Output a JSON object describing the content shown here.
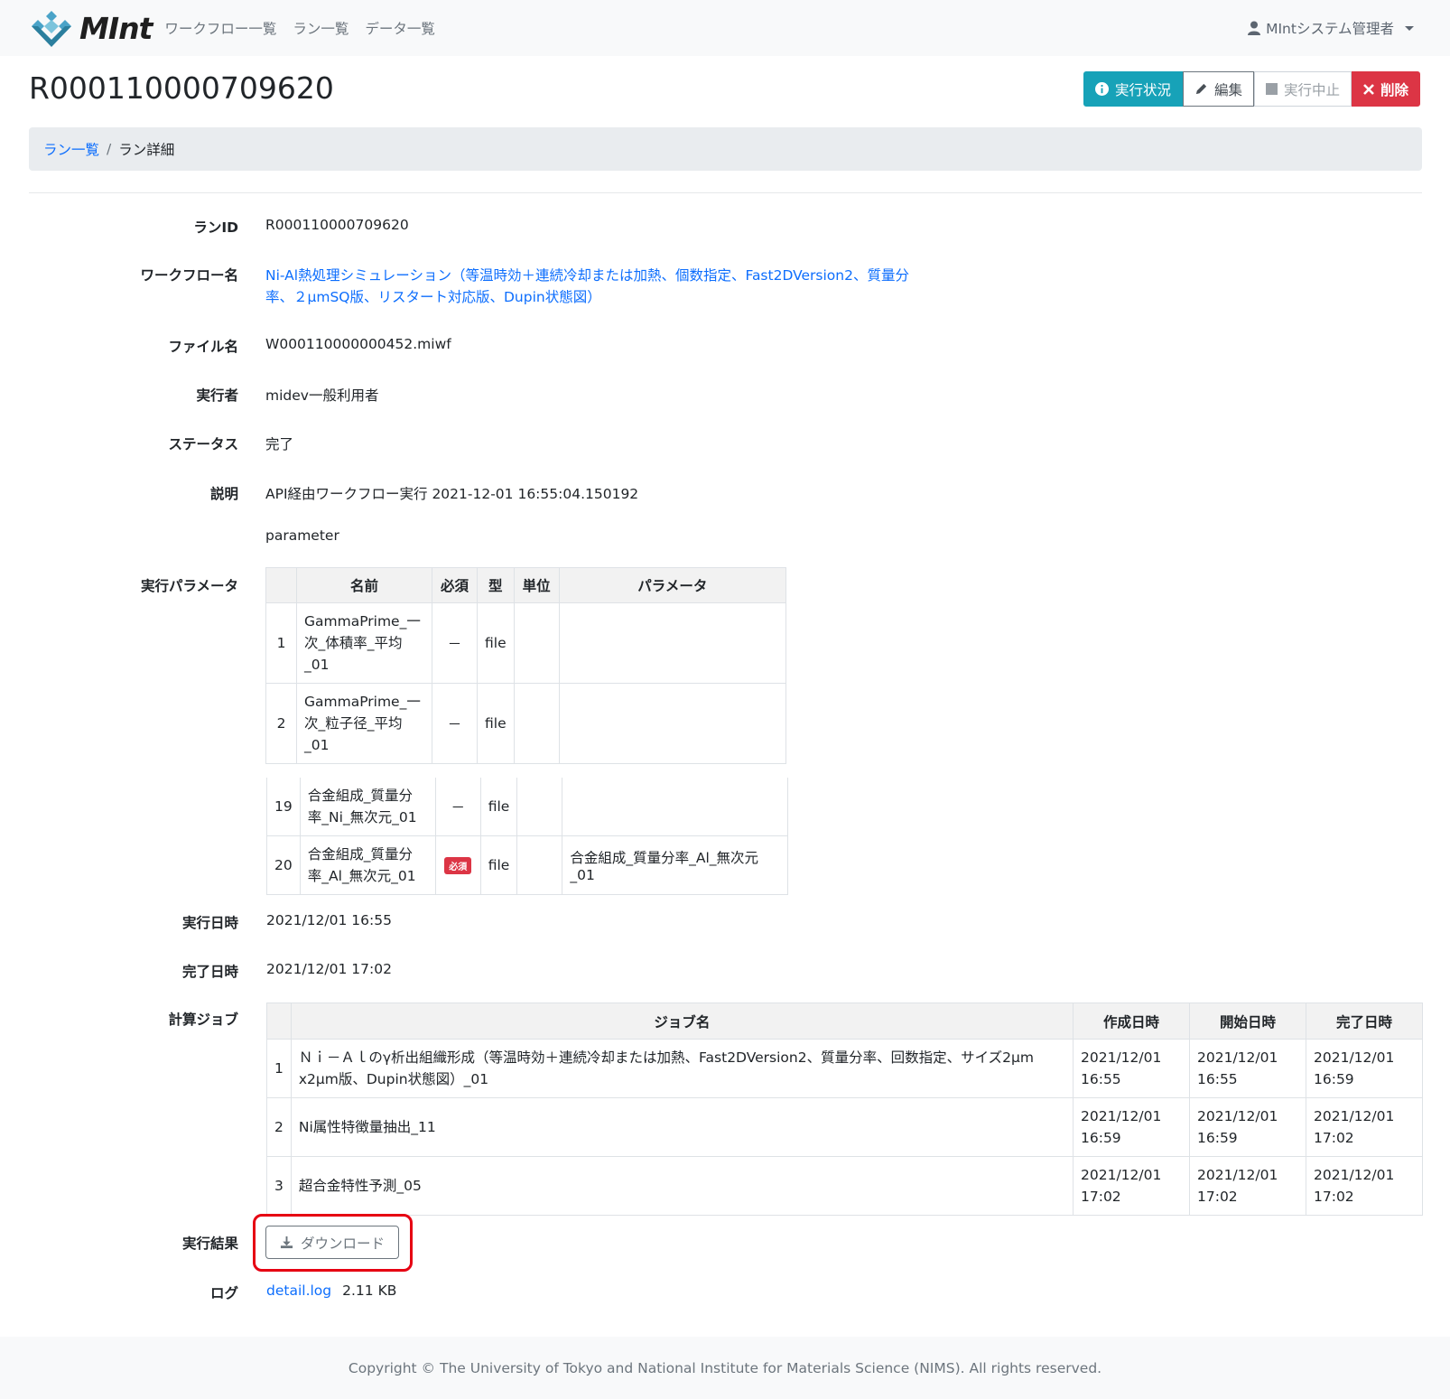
{
  "nav": {
    "brand": "MInt",
    "links": [
      "ワークフロー一覧",
      "ラン一覧",
      "データ一覧"
    ],
    "user": "MIntシステム管理者"
  },
  "header": {
    "title": "R000110000709620",
    "buttons": {
      "status": "実行状況",
      "edit": "編集",
      "stop": "実行中止",
      "delete": "削除"
    }
  },
  "breadcrumb": {
    "parent": "ラン一覧",
    "separator": "/",
    "current": "ラン詳細"
  },
  "details": {
    "run_id_label": "ランID",
    "run_id": "R000110000709620",
    "workflow_label": "ワークフロー名",
    "workflow_line1": "Ni-Al熱処理シミュレーション（等温時効＋連続冷却または加熱、個数指定、Fast2DVersion2、質量分",
    "workflow_line2": "率、２μmSQ版、リスタート対応版、Dupin状態図）",
    "file_label": "ファイル名",
    "file": "W000110000000452.miwf",
    "executor_label": "実行者",
    "executor": "midev一般利用者",
    "status_label": "ステータス",
    "status": "完了",
    "desc_label": "説明",
    "desc": "API経由ワークフロー実行 2021-12-01 16:55:04.150192",
    "desc_sub": "parameter",
    "params_label": "実行パラメータ",
    "start_label": "実行日時",
    "start": "2021/12/01 16:55",
    "end_label": "完了日時",
    "end": "2021/12/01 17:02",
    "jobs_label": "計算ジョブ",
    "result_label": "実行結果",
    "download": "ダウンロード",
    "log_label": "ログ",
    "log_file": "detail.log",
    "log_size": "2.11 KB"
  },
  "params_table": {
    "headers": [
      "",
      "名前",
      "必須",
      "型",
      "単位",
      "パラメータ"
    ],
    "rows": [
      {
        "no": "1",
        "name": [
          "GammaPrime_一",
          "次_体積率_平均",
          "_01"
        ],
        "req": "－",
        "type": "file",
        "unit": "",
        "param": ""
      },
      {
        "no": "2",
        "name": [
          "GammaPrime_一",
          "次_粒子径_平均",
          "_01"
        ],
        "req": "－",
        "type": "file",
        "unit": "",
        "param": ""
      },
      {
        "no": "19",
        "name": [
          "合金組成_質量分",
          "率_Ni_無次元_01"
        ],
        "req": "－",
        "type": "file",
        "unit": "",
        "param": ""
      },
      {
        "no": "20",
        "name": [
          "合金組成_質量分",
          "率_Al_無次元_01"
        ],
        "req": "必須",
        "type": "file",
        "unit": "",
        "param": "合金組成_質量分率_Al_無次元_01"
      }
    ]
  },
  "jobs_table": {
    "headers": [
      "",
      "ジョブ名",
      "作成日時",
      "開始日時",
      "完了日時"
    ],
    "rows": [
      {
        "no": "1",
        "name": [
          "Ｎｉ－Ａｌのγ析出組織形成（等温時効＋連続冷却または加熱、Fast2DVersion2、質量分率、回数指定、サイズ2μm",
          "x2μm版、Dupin状態図）_01"
        ],
        "created": [
          "2021/12/01",
          "16:55"
        ],
        "started": [
          "2021/12/01",
          "16:55"
        ],
        "finished": [
          "2021/12/01",
          "16:59"
        ]
      },
      {
        "no": "2",
        "name": [
          "Ni属性特徴量抽出_11"
        ],
        "created": [
          "2021/12/01",
          "16:59"
        ],
        "started": [
          "2021/12/01",
          "16:59"
        ],
        "finished": [
          "2021/12/01",
          "17:02"
        ]
      },
      {
        "no": "3",
        "name": [
          "超合金特性予測_05"
        ],
        "created": [
          "2021/12/01",
          "17:02"
        ],
        "started": [
          "2021/12/01",
          "17:02"
        ],
        "finished": [
          "2021/12/01",
          "17:02"
        ]
      }
    ]
  },
  "footer": "Copyright © The University of Tokyo and National Institute for Materials Science (NIMS). All rights reserved.",
  "colors": {
    "info": "#17a2b8",
    "danger": "#dc3545",
    "link": "#0d6efd",
    "highlight": "#e60012"
  }
}
